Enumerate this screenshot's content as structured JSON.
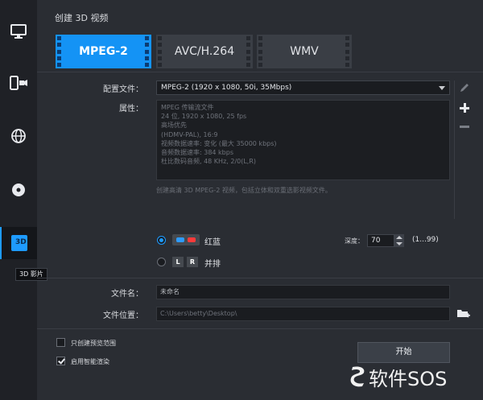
{
  "sidebar": {
    "tooltip": "3D 影片",
    "items": [
      {
        "icon": "monitor-icon"
      },
      {
        "icon": "device-icon"
      },
      {
        "icon": "globe-icon"
      },
      {
        "icon": "disc-icon"
      },
      {
        "icon": "3d-icon",
        "label": "3D",
        "active": true
      }
    ]
  },
  "header": {
    "title": "创建 3D 视频"
  },
  "format_tabs": [
    {
      "label": "MPEG-2",
      "active": true
    },
    {
      "label": "AVC/H.264",
      "active": false
    },
    {
      "label": "WMV",
      "active": false
    }
  ],
  "profile": {
    "label": "配置文件：",
    "value": "MPEG-2 (1920 x 1080, 50i, 35Mbps)"
  },
  "attributes": {
    "label": "属性：",
    "lines": [
      "MPEG 传输流文件",
      "24 位, 1920 x 1080, 25 fps",
      "高场优先",
      "(HDMV-PAL), 16:9",
      "视频数据速率: 变化 (最大 35000 kbps)",
      "音频数据速率: 384 kbps",
      "杜比数码音频, 48 KHz, 2/0(L,R)"
    ]
  },
  "description": "创建高清 3D MPEG-2 视频，包括立体和双重选影视频文件。",
  "mode": {
    "anaglyph_label": "红蓝",
    "side_by_side_label": "并排",
    "selected": "anaglyph",
    "lr_left": "L",
    "lr_right": "R"
  },
  "depth": {
    "label": "深度：",
    "value": "70",
    "range": "(1...99)"
  },
  "file": {
    "name_label": "文件名：",
    "name_value": "未命名",
    "location_label": "文件位置：",
    "location_value": "C:\\Users\\betty\\Desktop\\"
  },
  "options": {
    "preview_only_label": "只创建预览范围",
    "preview_only_checked": false,
    "smart_render_label": "启用智能渲染",
    "smart_render_checked": true
  },
  "start_button": "开始",
  "watermark": {
    "text": "软件SOS"
  },
  "colors": {
    "accent": "#1493f5",
    "background": "#2a2d33",
    "sidebar": "#1f2126"
  }
}
